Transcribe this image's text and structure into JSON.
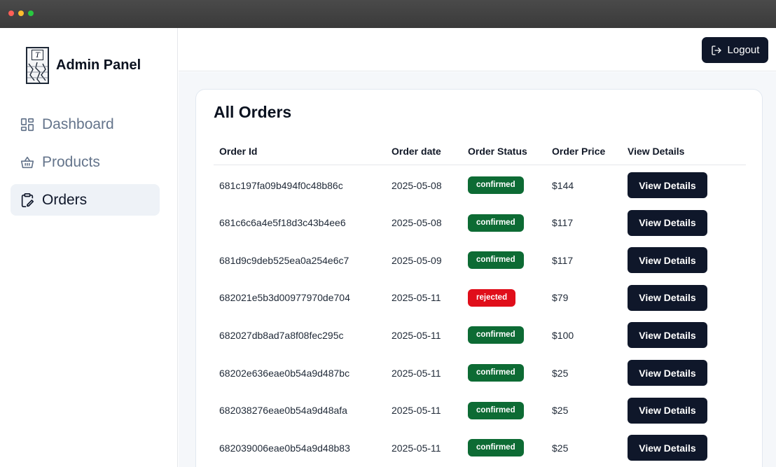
{
  "sidebar": {
    "brand": "Admin Panel",
    "logo_letter": "T",
    "items": [
      {
        "label": "Dashboard",
        "icon": "dashboard-grid-icon",
        "active": false
      },
      {
        "label": "Products",
        "icon": "basket-icon",
        "active": false
      },
      {
        "label": "Orders",
        "icon": "clipboard-edit-icon",
        "active": true
      }
    ]
  },
  "header": {
    "logout_label": "Logout",
    "logout_icon": "logout-icon"
  },
  "main": {
    "title": "All Orders",
    "columns": [
      "Order Id",
      "Order date",
      "Order Status",
      "Order Price",
      "View Details"
    ],
    "view_label": "View Details",
    "colors": {
      "confirmed": "#0d6b34",
      "rejected": "#e00e1a",
      "button": "#0f172a"
    },
    "rows": [
      {
        "id": "681c197fa09b494f0c48b86c",
        "date": "2025-05-08",
        "status": "confirmed",
        "price": "$144"
      },
      {
        "id": "681c6c6a4e5f18d3c43b4ee6",
        "date": "2025-05-08",
        "status": "confirmed",
        "price": "$117"
      },
      {
        "id": "681d9c9deb525ea0a254e6c7",
        "date": "2025-05-09",
        "status": "confirmed",
        "price": "$117"
      },
      {
        "id": "682021e5b3d00977970de704",
        "date": "2025-05-11",
        "status": "rejected",
        "price": "$79"
      },
      {
        "id": "682027db8ad7a8f08fec295c",
        "date": "2025-05-11",
        "status": "confirmed",
        "price": "$100"
      },
      {
        "id": "68202e636eae0b54a9d487bc",
        "date": "2025-05-11",
        "status": "confirmed",
        "price": "$25"
      },
      {
        "id": "682038276eae0b54a9d48afa",
        "date": "2025-05-11",
        "status": "confirmed",
        "price": "$25"
      },
      {
        "id": "682039006eae0b54a9d48b83",
        "date": "2025-05-11",
        "status": "confirmed",
        "price": "$25"
      }
    ]
  }
}
